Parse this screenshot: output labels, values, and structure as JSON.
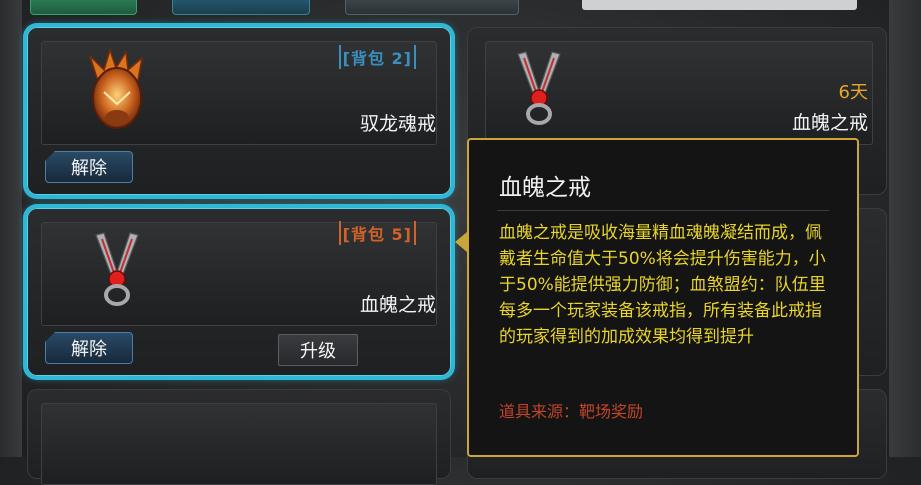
{
  "slots": [
    {
      "bag_label": "[背包 2]",
      "name": "驭龙魂戒",
      "action_label": "解除"
    },
    {
      "bag_label": "[背包 5]",
      "name": "血魄之戒",
      "action_label": "解除",
      "upgrade_label": "升级"
    }
  ],
  "preview": {
    "days": "6天",
    "name": "血魄之戒"
  },
  "tooltip": {
    "title": "血魄之戒",
    "description": "血魄之戒是吸收海量精血魂魄凝结而成，佩戴者生命值大于50%将会提升伤害能力，小于50%能提供强力防御；血煞盟约：队伍里每多一个玩家装备该戒指，所有装备此戒指的玩家得到的加成效果均得到提升",
    "source": "道具来源：靶场奖励"
  },
  "colors": {
    "selected_border": "#2fb8d6",
    "tooltip_border": "#c9a53a",
    "description": "#e8d42a",
    "source": "#c2442a",
    "days": "#e6a72a"
  }
}
